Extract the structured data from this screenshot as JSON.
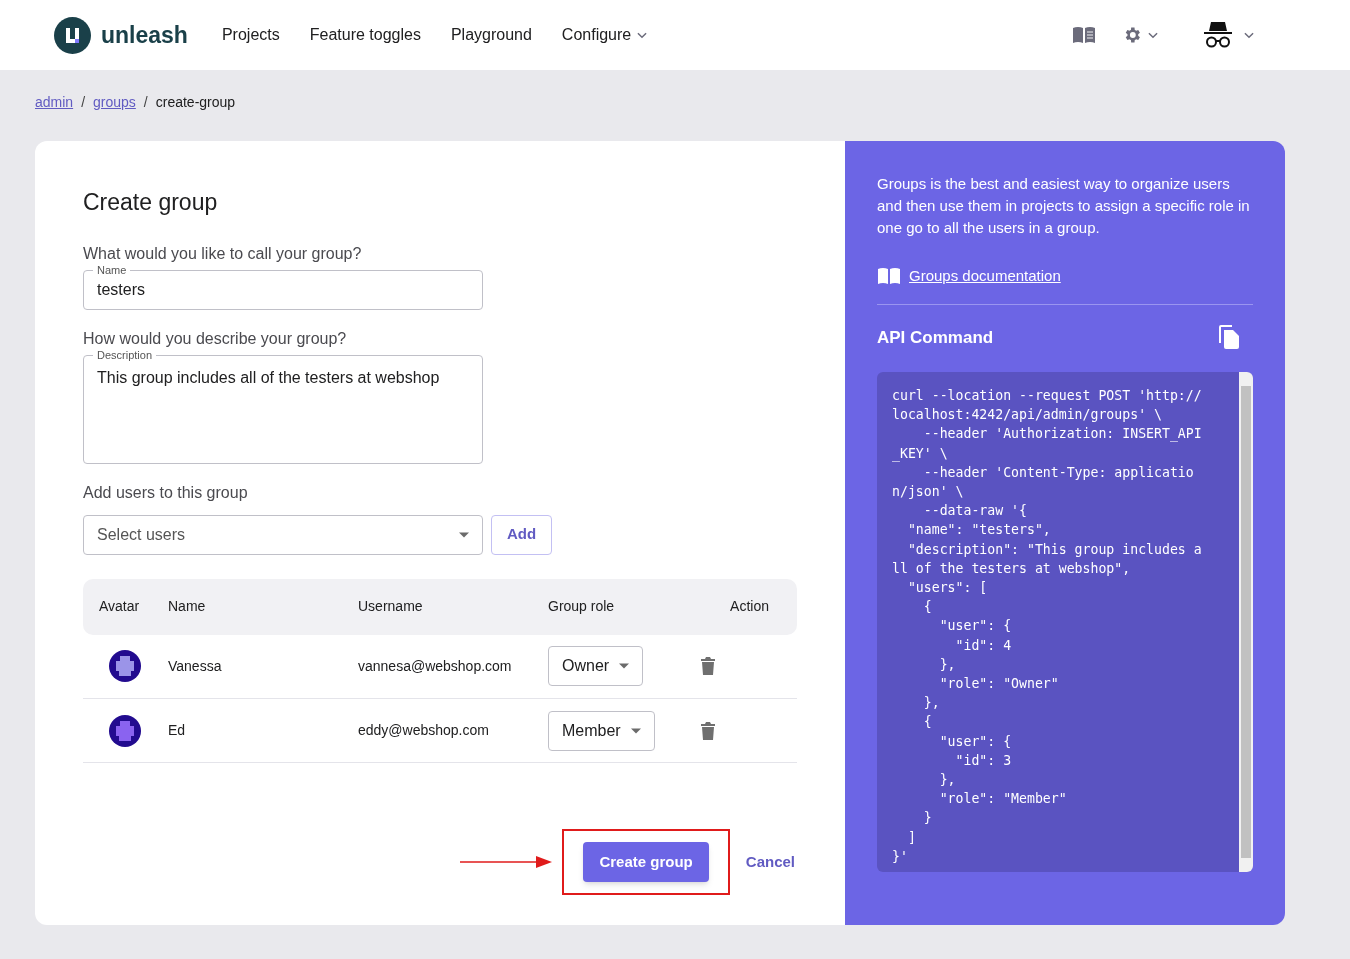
{
  "nav": {
    "logo": "unleash",
    "items": [
      {
        "label": "Projects",
        "dropdown": false
      },
      {
        "label": "Feature toggles",
        "dropdown": false
      },
      {
        "label": "Playground",
        "dropdown": false
      },
      {
        "label": "Configure",
        "dropdown": true
      }
    ]
  },
  "breadcrumbs": {
    "separator": "/",
    "items": [
      {
        "label": "admin",
        "link": true
      },
      {
        "label": "groups",
        "link": true
      },
      {
        "label": "create-group",
        "link": false
      }
    ]
  },
  "form": {
    "title": "Create group",
    "name_question": "What would you like to call your group?",
    "name_label": "Name",
    "name_value": "testers",
    "description_question": "How would you describe your group?",
    "description_label": "Description",
    "description_value": "This group includes all of the testers at webshop",
    "users_question": "Add users to this group",
    "users_placeholder": "Select users",
    "add_button": "Add",
    "table": {
      "columns": [
        "Avatar",
        "Name",
        "Username",
        "Group role",
        "Action"
      ],
      "rows": [
        {
          "name": "Vanessa",
          "username": "vannesa@webshop.com",
          "role": "Owner",
          "color": "#9b94e8"
        },
        {
          "name": "Ed",
          "username": "eddy@webshop.com",
          "role": "Member",
          "color": "#8a63f0"
        }
      ]
    },
    "submit": "Create group",
    "cancel": "Cancel"
  },
  "sidebar": {
    "description": "Groups is the best and easiest way to organize users and then use them in projects to assign a specific role in one go to all the users in a group.",
    "doc_link": "Groups documentation",
    "api_title": "API Command",
    "code_lines": [
      "curl --location --request POST 'http://",
      "localhost:4242/api/admin/groups' \\",
      "    --header 'Authorization: INSERT_API",
      "_KEY' \\",
      "    --header 'Content-Type: applicatio",
      "n/json' \\",
      "    --data-raw '{",
      "  \"name\": \"testers\",",
      "  \"description\": \"This group includes a",
      "ll of the testers at webshop\",",
      "  \"users\": [",
      "    {",
      "      \"user\": {",
      "        \"id\": 4",
      "      },",
      "      \"role\": \"Owner\"",
      "    },",
      "    {",
      "      \"user\": {",
      "        \"id\": 3",
      "      },",
      "      \"role\": \"Member\"",
      "    }",
      "  ]",
      "}'"
    ]
  }
}
